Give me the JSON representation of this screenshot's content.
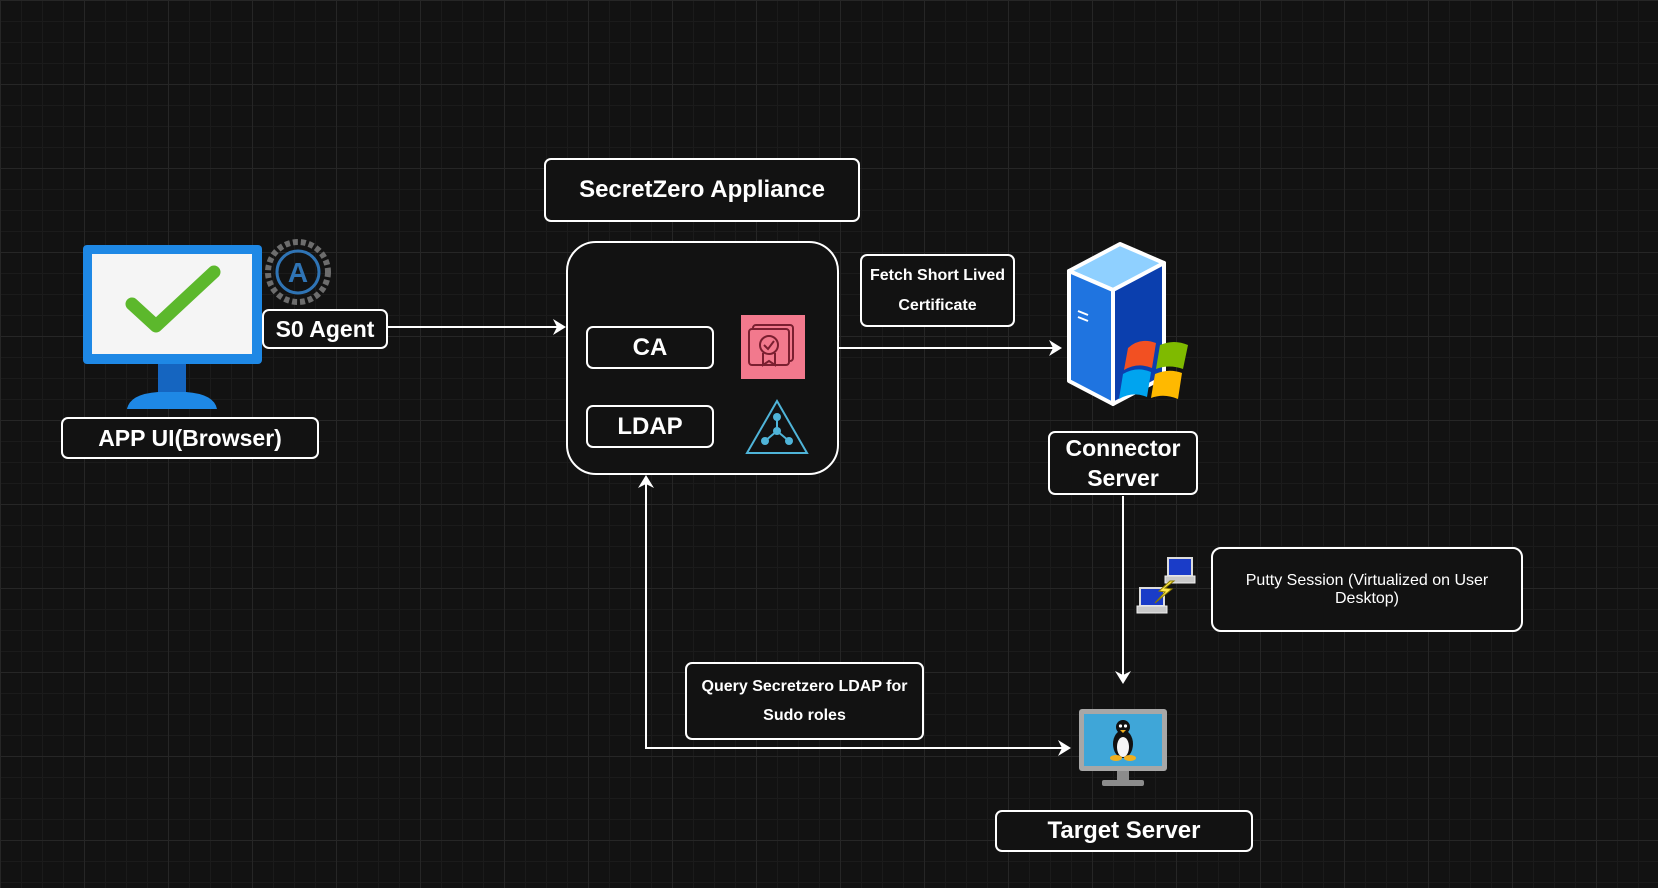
{
  "title": "SecretZero Appliance",
  "nodes": {
    "app_ui": {
      "label": "APP UI(Browser)"
    },
    "agent": {
      "label": "S0 Agent",
      "badge_icon": "automation-a-icon"
    },
    "appliance": {
      "ca_label": "CA",
      "ldap_label": "LDAP",
      "ca_icon": "certificate-icon",
      "ldap_icon": "directory-tree-icon"
    },
    "connector": {
      "label_line1": "Connector",
      "label_line2": "Server",
      "icon": "windows-server-icon"
    },
    "target": {
      "label": "Target Server",
      "icon": "linux-monitor-icon"
    }
  },
  "annotations": {
    "fetch_line1": "Fetch Short Lived",
    "fetch_line2": "Certificate",
    "query_line1": "Query Secretzero LDAP for",
    "query_line2": "Sudo roles",
    "putty": "Putty Session (Virtualized on User Desktop)"
  },
  "colors": {
    "background": "#121212",
    "stroke": "#ffffff",
    "monitor_blue": "#1e88e5",
    "check_green": "#5cb82c",
    "certificate_pink": "#f2798d",
    "ldap_teal": "#4fb4d8"
  }
}
